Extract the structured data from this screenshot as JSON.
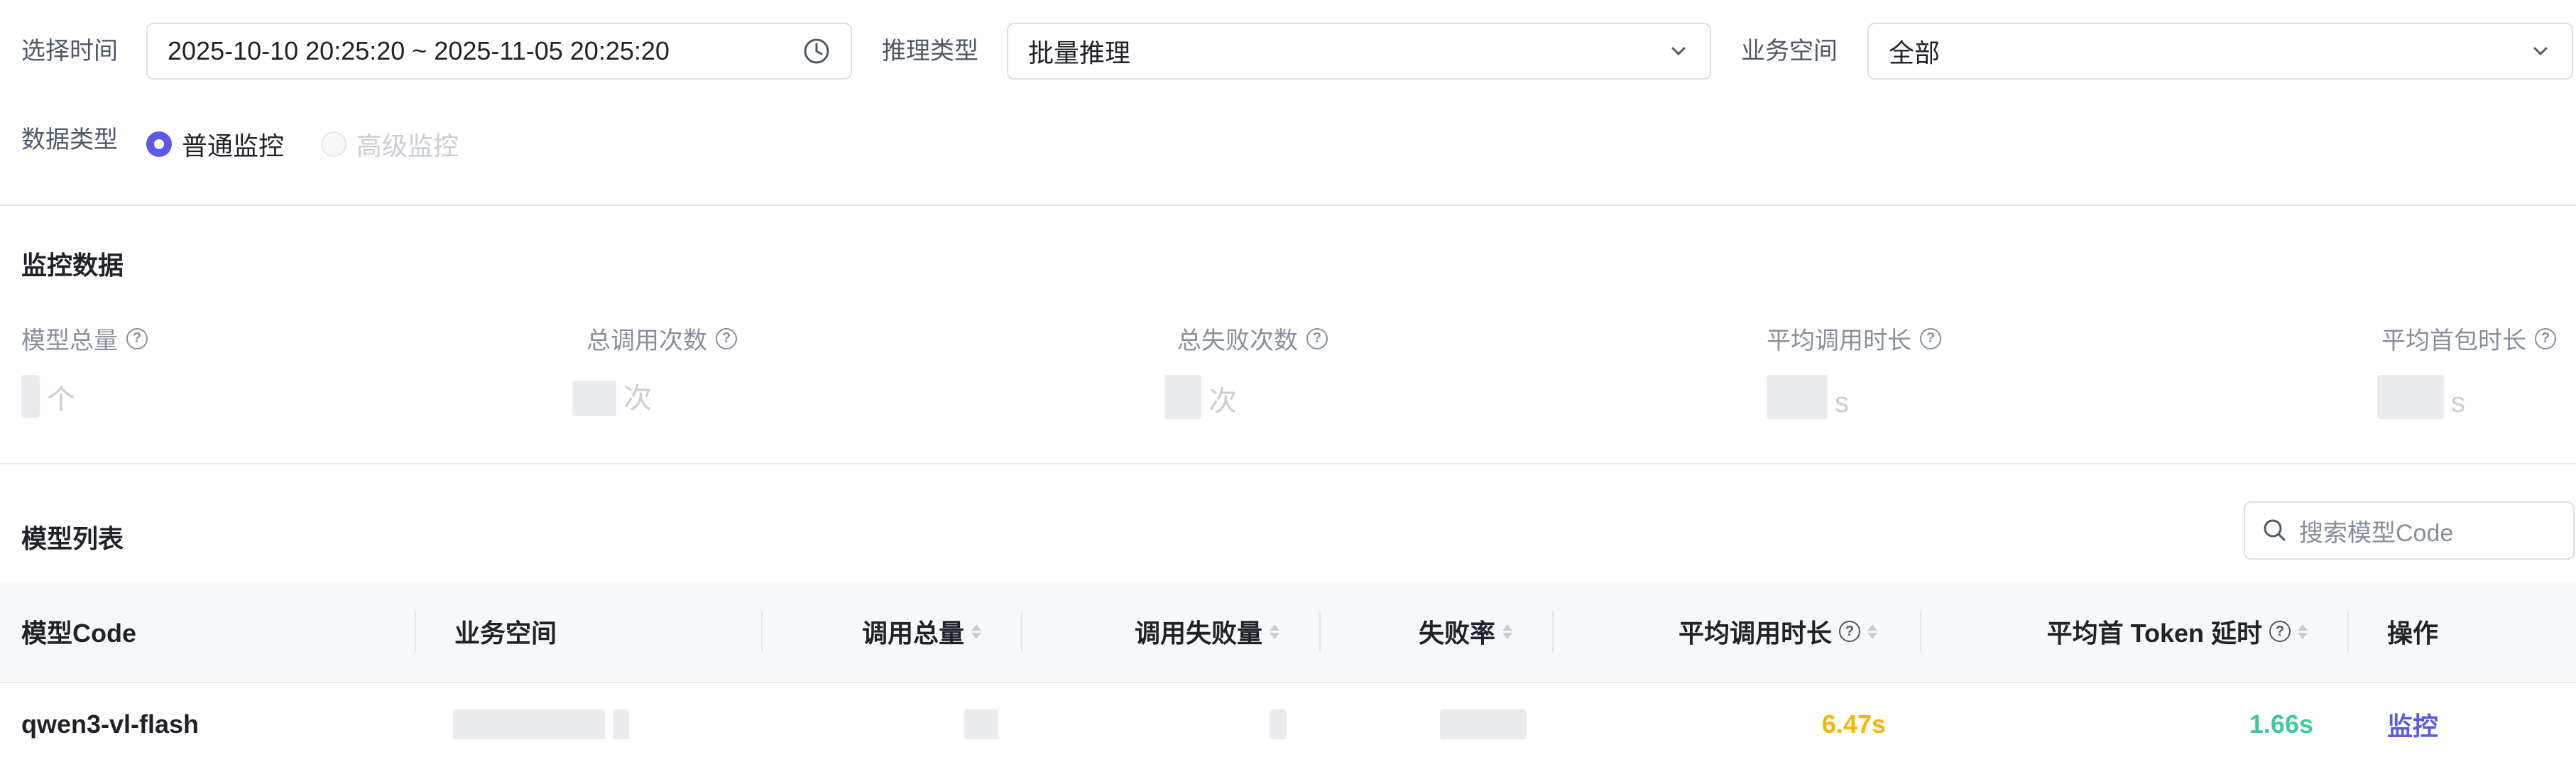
{
  "filters": {
    "time_label": "选择时间",
    "time_value": "2025-10-10 20:25:20 ~ 2025-11-05 20:25:20",
    "infer_type_label": "推理类型",
    "infer_type_value": "批量推理",
    "workspace_label": "业务空间",
    "workspace_value": "全部",
    "data_type_label": "数据类型",
    "data_type_options": [
      {
        "label": "普通监控",
        "checked": true
      },
      {
        "label": "高级监控",
        "checked": false,
        "disabled": true
      }
    ]
  },
  "monitor": {
    "title": "监控数据",
    "metrics": [
      {
        "label": "模型总量",
        "unit": "个"
      },
      {
        "label": "总调用次数",
        "unit": "次"
      },
      {
        "label": "总失败次数",
        "unit": "次"
      },
      {
        "label": "平均调用时长",
        "unit": "s"
      },
      {
        "label": "平均首包时长",
        "unit": "s"
      }
    ]
  },
  "model_list": {
    "title": "模型列表",
    "search_placeholder": "搜索模型Code",
    "columns": [
      "模型Code",
      "业务空间",
      "调用总量",
      "调用失败量",
      "失败率",
      "平均调用时长",
      "平均首 Token 延时",
      "操作"
    ],
    "rows": [
      {
        "model_code": "qwen3-vl-flash",
        "avg_call_duration": "6.47s",
        "avg_first_token_latency": "1.66s",
        "action": "监控"
      }
    ]
  },
  "colors": {
    "accent": "#5a5ae6",
    "warning": "#f5b700",
    "success": "#3ec8a0"
  },
  "icons": {
    "time_field": "clock-icon",
    "dropdown": "chevron-down-icon",
    "help": "question-circle-icon",
    "search": "search-icon",
    "sort": "sort-icon"
  }
}
